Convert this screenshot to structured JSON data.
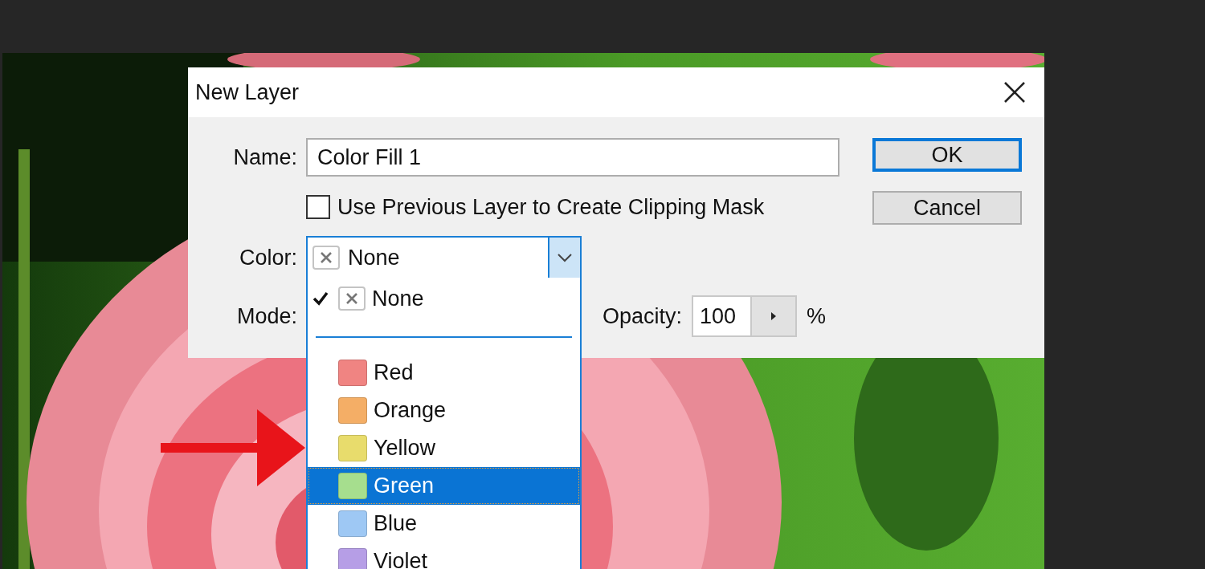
{
  "window": {
    "title": "New Layer"
  },
  "name_field": {
    "label": "Name:",
    "value": "Color Fill 1"
  },
  "clipping_checkbox": {
    "label": "Use Previous Layer to Create Clipping Mask",
    "checked": false
  },
  "color_select": {
    "label": "Color:",
    "value": "None"
  },
  "mode": {
    "label": "Mode:"
  },
  "opacity": {
    "label": "Opacity:",
    "value": "100",
    "unit": "%"
  },
  "buttons": [
    {
      "label": "OK",
      "default": true
    },
    {
      "label": "Cancel",
      "default": false
    }
  ],
  "color_menu": {
    "items": [
      {
        "kind": "none",
        "label": "None",
        "checked": true,
        "selected": false
      },
      {
        "kind": "swatch",
        "label": "Red",
        "color": "#f08482",
        "checked": false,
        "selected": false
      },
      {
        "kind": "swatch",
        "label": "Orange",
        "color": "#f4ae66",
        "checked": false,
        "selected": false
      },
      {
        "kind": "swatch",
        "label": "Yellow",
        "color": "#e8dc6c",
        "checked": false,
        "selected": false
      },
      {
        "kind": "swatch",
        "label": "Green",
        "color": "#a6de8e",
        "checked": false,
        "selected": true
      },
      {
        "kind": "swatch",
        "label": "Blue",
        "color": "#9ec8f4",
        "checked": false,
        "selected": false
      },
      {
        "kind": "swatch",
        "label": "Violet",
        "color": "#b69ee6",
        "checked": false,
        "selected": false
      }
    ]
  }
}
